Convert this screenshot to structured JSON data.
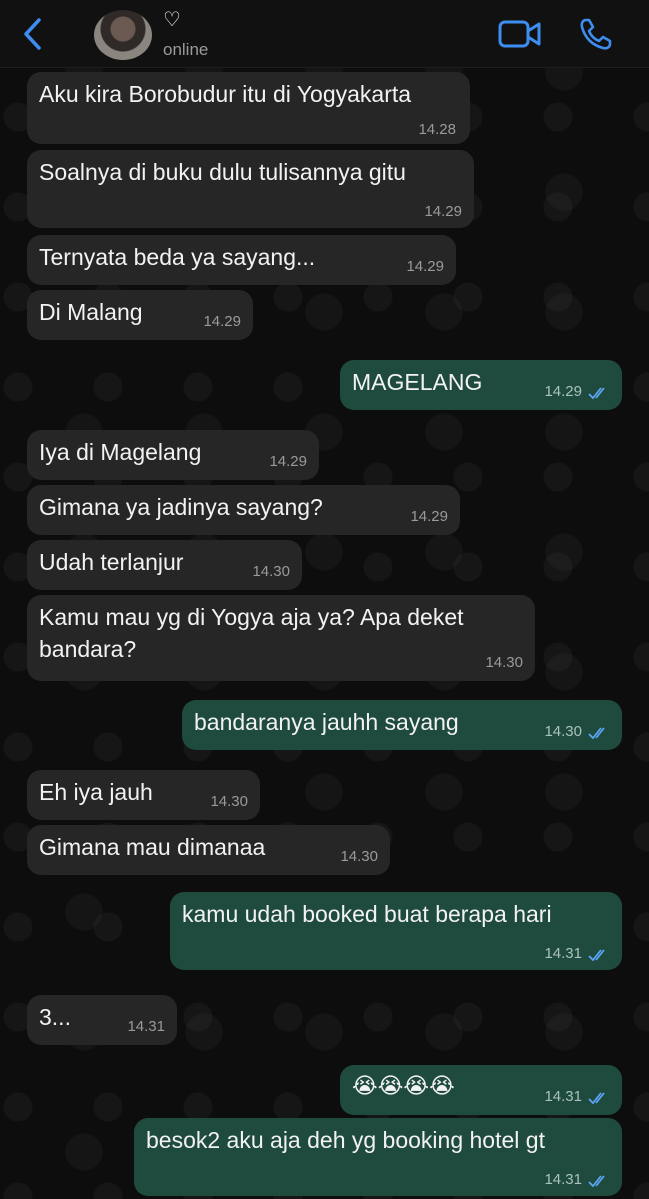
{
  "header": {
    "contact_name": "♡",
    "status": "online"
  },
  "messages": [
    {
      "dir": "in",
      "text": "Aku kira Borobudur itu di Yogyakarta",
      "time": "14.28"
    },
    {
      "dir": "in",
      "text": "Soalnya di buku dulu tulisannya gitu",
      "time": "14.29"
    },
    {
      "dir": "in",
      "text": "Ternyata beda ya sayang...",
      "time": "14.29"
    },
    {
      "dir": "in",
      "text": "Di Malang",
      "time": "14.29"
    },
    {
      "dir": "out",
      "text": "MAGELANG",
      "time": "14.29",
      "read": true
    },
    {
      "dir": "in",
      "text": "Iya di Magelang",
      "time": "14.29"
    },
    {
      "dir": "in",
      "text": "Gimana ya jadinya sayang?",
      "time": "14.29"
    },
    {
      "dir": "in",
      "text": "Udah terlanjur",
      "time": "14.30"
    },
    {
      "dir": "in",
      "text": "Kamu mau yg di Yogya aja ya? Apa deket bandara?",
      "time": "14.30"
    },
    {
      "dir": "out",
      "text": "bandaranya jauhh sayang",
      "time": "14.30",
      "read": true
    },
    {
      "dir": "in",
      "text": "Eh iya jauh",
      "time": "14.30"
    },
    {
      "dir": "in",
      "text": "Gimana mau dimanaa",
      "time": "14.30"
    },
    {
      "dir": "out",
      "text": "kamu udah booked buat berapa hari",
      "time": "14.31",
      "read": true
    },
    {
      "dir": "in",
      "text": "3...",
      "time": "14.31"
    },
    {
      "dir": "out",
      "text": "😭😭😭😭",
      "time": "14.31",
      "read": true
    },
    {
      "dir": "out",
      "text": "besok2 aku aja deh yg booking hotel gt",
      "time": "14.31",
      "read": true
    }
  ],
  "colors": {
    "accent": "#3d8ef0",
    "incoming_bubble": "#262626",
    "outgoing_bubble": "#1f4a3e",
    "read_ticks": "#5aa6f5"
  },
  "icons": {
    "back": "chevron-left-icon",
    "video": "video-camera-icon",
    "call": "phone-icon"
  }
}
